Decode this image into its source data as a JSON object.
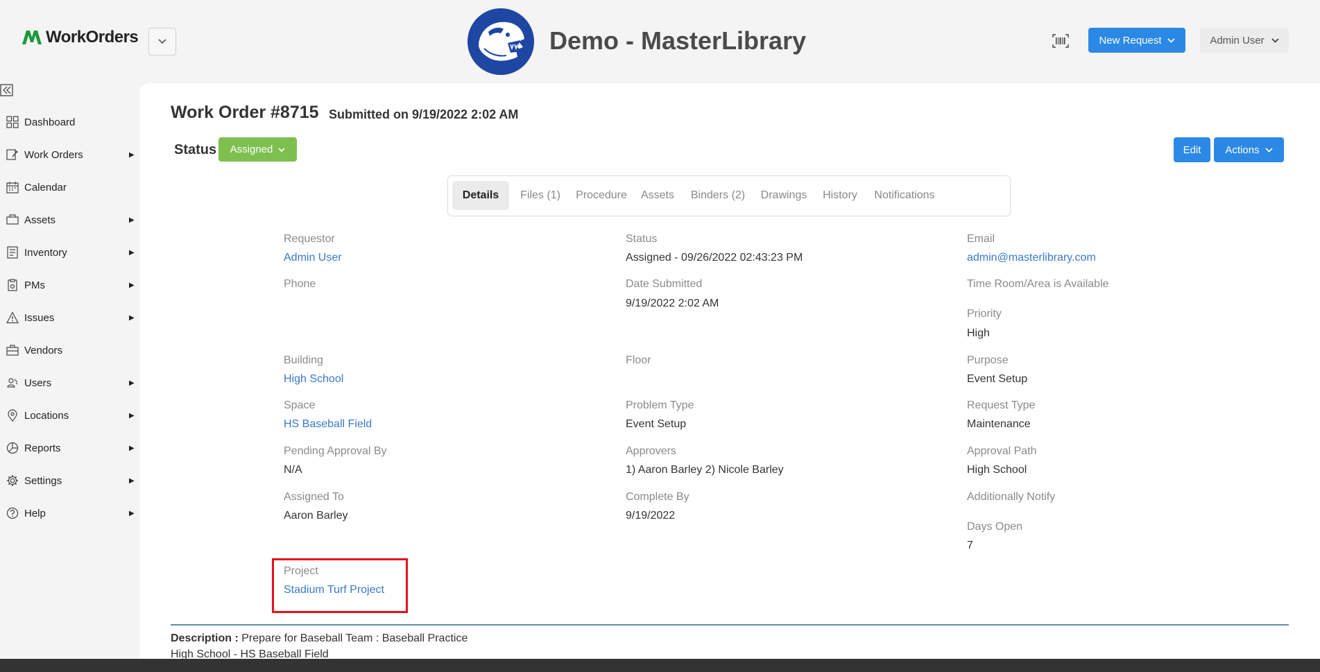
{
  "header": {
    "app_name": "WorkOrders",
    "org_title": "Demo - MasterLibrary",
    "new_request_label": "New Request",
    "user_label": "Admin User"
  },
  "sidebar": {
    "items": [
      {
        "label": "Dashboard",
        "icon": "dashboard-icon",
        "has_submenu": false
      },
      {
        "label": "Work Orders",
        "icon": "work-orders-icon",
        "has_submenu": true
      },
      {
        "label": "Calendar",
        "icon": "calendar-icon",
        "has_submenu": false
      },
      {
        "label": "Assets",
        "icon": "assets-icon",
        "has_submenu": true
      },
      {
        "label": "Inventory",
        "icon": "inventory-icon",
        "has_submenu": true
      },
      {
        "label": "PMs",
        "icon": "pms-icon",
        "has_submenu": true
      },
      {
        "label": "Issues",
        "icon": "issues-icon",
        "has_submenu": true
      },
      {
        "label": "Vendors",
        "icon": "vendors-icon",
        "has_submenu": false
      },
      {
        "label": "Users",
        "icon": "users-icon",
        "has_submenu": true
      },
      {
        "label": "Locations",
        "icon": "locations-icon",
        "has_submenu": true
      },
      {
        "label": "Reports",
        "icon": "reports-icon",
        "has_submenu": true
      },
      {
        "label": "Settings",
        "icon": "settings-icon",
        "has_submenu": true
      },
      {
        "label": "Help",
        "icon": "help-icon",
        "has_submenu": true
      }
    ]
  },
  "work_order": {
    "title": "Work Order #8715",
    "submitted": "Submitted on 9/19/2022 2:02 AM",
    "status_label": "Status",
    "status_value": "Assigned",
    "status_color": "#7dc04f",
    "edit_label": "Edit",
    "actions_label": "Actions"
  },
  "tabs": [
    "Details",
    "Files (1)",
    "Procedure",
    "Assets",
    "Binders (2)",
    "Drawings",
    "History",
    "Notifications"
  ],
  "active_tab": "Details",
  "fields": {
    "requestor": {
      "label": "Requestor",
      "value": "Admin User"
    },
    "status": {
      "label": "Status",
      "value": "Assigned - 09/26/2022 02:43:23 PM"
    },
    "email": {
      "label": "Email",
      "value": "admin@masterlibrary.com"
    },
    "phone": {
      "label": "Phone",
      "value": ""
    },
    "date_submitted": {
      "label": "Date Submitted",
      "value": "9/19/2022 2:02 AM"
    },
    "time_room": {
      "label": "Time Room/Area is Available",
      "value": ""
    },
    "priority": {
      "label": "Priority",
      "value": "High"
    },
    "building": {
      "label": "Building",
      "value": "High School"
    },
    "floor": {
      "label": "Floor",
      "value": ""
    },
    "purpose": {
      "label": "Purpose",
      "value": "Event Setup"
    },
    "space": {
      "label": "Space",
      "value": "HS Baseball Field"
    },
    "problem_type": {
      "label": "Problem Type",
      "value": "Event Setup"
    },
    "request_type": {
      "label": "Request Type",
      "value": "Maintenance"
    },
    "pending_approval": {
      "label": "Pending Approval By",
      "value": "N/A"
    },
    "approvers": {
      "label": "Approvers",
      "value": "1) Aaron Barley 2) Nicole Barley"
    },
    "approval_path": {
      "label": "Approval Path",
      "value": "High School"
    },
    "assigned_to": {
      "label": "Assigned To",
      "value": "Aaron Barley"
    },
    "complete_by": {
      "label": "Complete By",
      "value": "9/19/2022"
    },
    "additionally_notify": {
      "label": "Additionally Notify",
      "value": ""
    },
    "days_open": {
      "label": "Days Open",
      "value": "7"
    },
    "project": {
      "label": "Project",
      "value": "Stadium Turf Project"
    }
  },
  "description": {
    "label": "Description :",
    "text": " Prepare for Baseball Team : Baseball Practice",
    "line2": "High School - HS Baseball Field"
  },
  "colors": {
    "accent": "#2b88e4",
    "link": "#3a78c9",
    "highlight": "#e8101d",
    "brand_green": "#1c9a3b"
  }
}
